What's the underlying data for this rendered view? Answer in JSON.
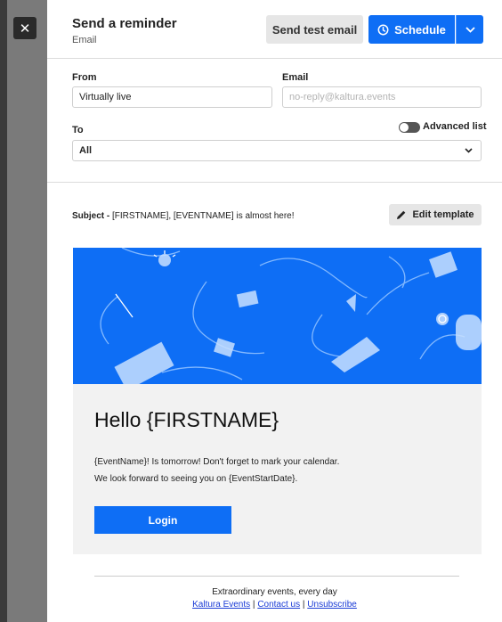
{
  "header": {
    "title": "Send a reminder",
    "subtitle": "Email",
    "test_button": "Send test email",
    "schedule_button": "Schedule"
  },
  "form": {
    "from_label": "From",
    "from_value": "Virtually live",
    "email_label": "Email",
    "email_placeholder": "no-reply@kaltura.events",
    "to_label": "To",
    "to_value": "All",
    "advanced_label": "Advanced list",
    "advanced_enabled": false
  },
  "subject": {
    "prefix": "Subject - ",
    "text": "[FIRSTNAME], [EVENTNAME] is almost here!",
    "edit_button": "Edit template"
  },
  "preview": {
    "greeting": "Hello {FIRSTNAME}",
    "line1": "{EventName}! Is tomorrow! Don't forget to mark your calendar.",
    "line2": "We look forward to seeing you on {EventStartDate}.",
    "login_button": "Login"
  },
  "footer": {
    "tagline": "Extraordinary events, every day",
    "link1": "Kaltura Events",
    "sep1": " | ",
    "link2": "Contact us",
    "sep2": " | ",
    "link3": "Unsubscribe"
  },
  "colors": {
    "accent": "#0e6ef5",
    "rail": "#7a7a7a"
  }
}
